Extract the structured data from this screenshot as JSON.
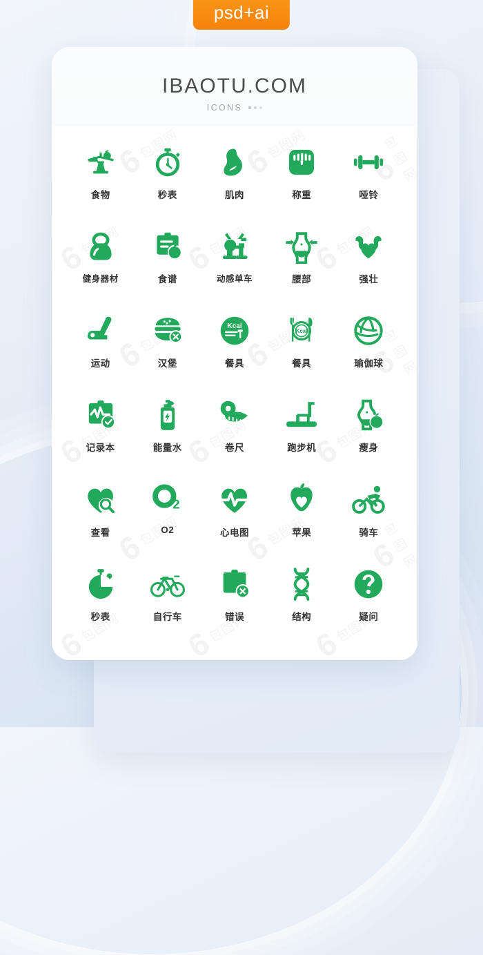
{
  "badge": {
    "label": "psd+ai",
    "color": "#f5820c"
  },
  "header": {
    "brand": "IBAOTU.COM",
    "subtitle": "ICONS"
  },
  "theme": {
    "icon_green": "#22a95c",
    "background": "#dde7f4",
    "card": "#ffffff",
    "label_color": "#333333"
  },
  "watermark": {
    "glyph": "6",
    "text": "包图网"
  },
  "grid": {
    "columns": 5,
    "rows": 6,
    "icons": [
      {
        "label": "食物",
        "icon": "food-balance-scale-icon"
      },
      {
        "label": "秒表",
        "icon": "stopwatch-outline-icon"
      },
      {
        "label": "肌肉",
        "icon": "muscle-arm-icon"
      },
      {
        "label": "称重",
        "icon": "weight-scale-icon"
      },
      {
        "label": "哑铃",
        "icon": "dumbbell-icon"
      },
      {
        "label": "健身器材",
        "icon": "kettlebell-icon"
      },
      {
        "label": "食谱",
        "icon": "recipe-clipboard-apple-icon"
      },
      {
        "label": "动感单车",
        "icon": "spin-bike-icon"
      },
      {
        "label": "腰部",
        "icon": "waist-measure-icon"
      },
      {
        "label": "强壮",
        "icon": "strong-heart-arms-icon"
      },
      {
        "label": "运动",
        "icon": "exercise-step-icon"
      },
      {
        "label": "汉堡",
        "icon": "burger-forbidden-icon"
      },
      {
        "label": "餐具",
        "icon": "kcal-circle-fork-icon"
      },
      {
        "label": "餐具",
        "icon": "kcal-plate-cutlery-icon"
      },
      {
        "label": "瑜伽球",
        "icon": "yoga-ball-icon"
      },
      {
        "label": "记录本",
        "icon": "record-notebook-check-icon"
      },
      {
        "label": "能量水",
        "icon": "energy-drink-bottle-icon"
      },
      {
        "label": "卷尺",
        "icon": "measuring-tape-icon"
      },
      {
        "label": "跑步机",
        "icon": "treadmill-icon"
      },
      {
        "label": "瘦身",
        "icon": "slimming-body-apple-icon"
      },
      {
        "label": "查看",
        "icon": "heart-search-icon"
      },
      {
        "label": "O2",
        "icon": "oxygen-o2-icon"
      },
      {
        "label": "心电图",
        "icon": "heart-ecg-icon"
      },
      {
        "label": "苹果",
        "icon": "apple-heart-icon"
      },
      {
        "label": "骑车",
        "icon": "cyclist-icon"
      },
      {
        "label": "秒表",
        "icon": "stopwatch-filled-icon"
      },
      {
        "label": "自行车",
        "icon": "bicycle-icon"
      },
      {
        "label": "错误",
        "icon": "clipboard-error-icon"
      },
      {
        "label": "结构",
        "icon": "dna-structure-icon"
      },
      {
        "label": "疑问",
        "icon": "question-circle-icon"
      }
    ]
  }
}
